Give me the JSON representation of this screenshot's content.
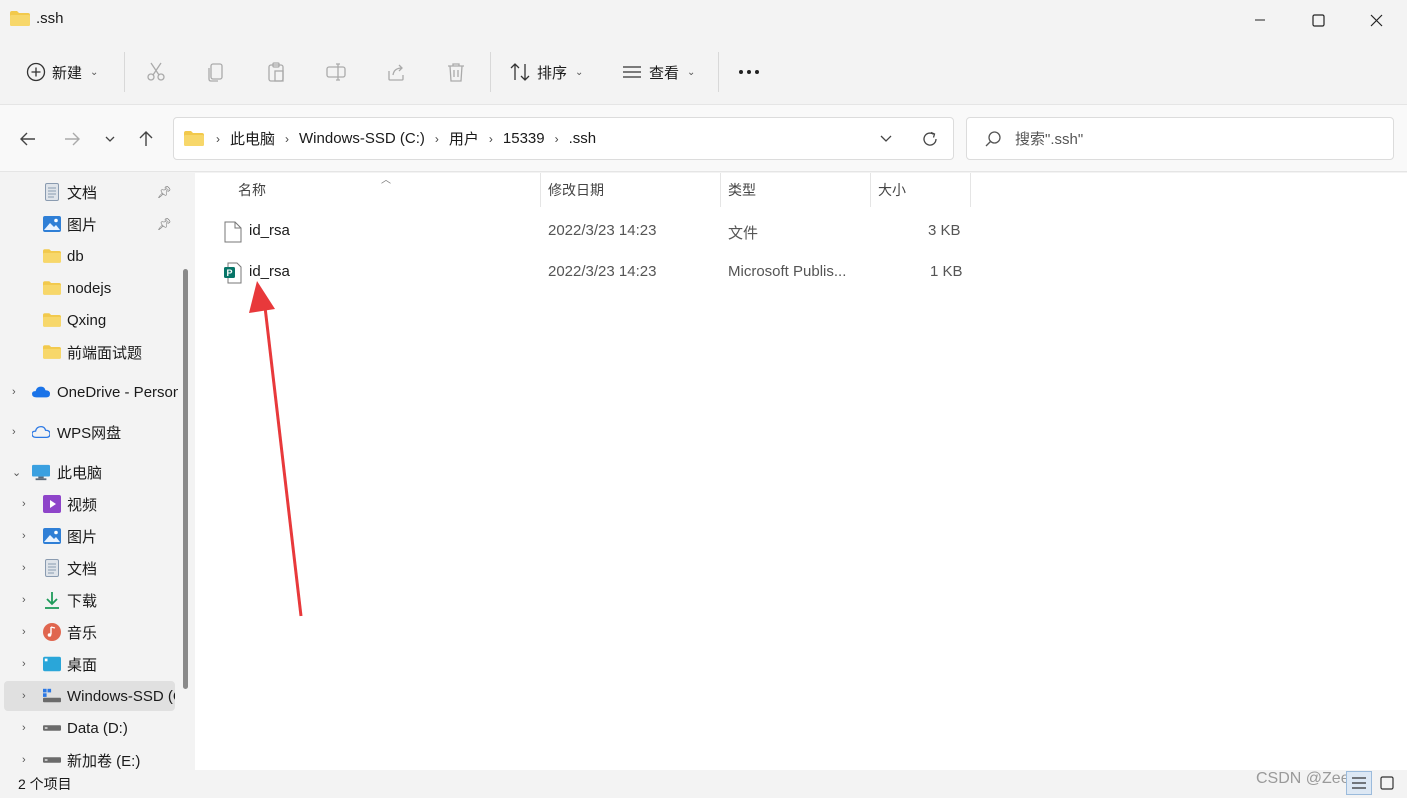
{
  "window": {
    "title": ".ssh"
  },
  "toolbar": {
    "new_label": "新建",
    "sort_label": "排序",
    "view_label": "查看"
  },
  "address": {
    "crumbs": [
      "此电脑",
      "Windows-SSD (C:)",
      "用户",
      "15339",
      ".ssh"
    ]
  },
  "search": {
    "placeholder": "搜索\".ssh\""
  },
  "sidebar": {
    "items": [
      {
        "label": "文档",
        "icon": "document-icon",
        "pinned": true
      },
      {
        "label": "图片",
        "icon": "pictures-icon",
        "pinned": true
      },
      {
        "label": "db",
        "icon": "folder-icon"
      },
      {
        "label": "nodejs",
        "icon": "folder-icon"
      },
      {
        "label": "Qxing",
        "icon": "folder-icon"
      },
      {
        "label": "前端面试题",
        "icon": "folder-icon"
      },
      {
        "label": "OneDrive - Personal",
        "icon": "onedrive-icon"
      },
      {
        "label": "WPS网盘",
        "icon": "wps-cloud-icon"
      },
      {
        "label": "此电脑",
        "icon": "computer-icon"
      },
      {
        "label": "视频",
        "icon": "videos-icon"
      },
      {
        "label": "图片",
        "icon": "pictures-icon"
      },
      {
        "label": "文档",
        "icon": "document-icon"
      },
      {
        "label": "下载",
        "icon": "downloads-icon"
      },
      {
        "label": "音乐",
        "icon": "music-icon"
      },
      {
        "label": "桌面",
        "icon": "desktop-icon"
      },
      {
        "label": "Windows-SSD (C:)",
        "icon": "drive-c-icon"
      },
      {
        "label": "Data (D:)",
        "icon": "drive-icon"
      },
      {
        "label": "新加卷 (E:)",
        "icon": "drive-icon"
      }
    ]
  },
  "columns": {
    "name": "名称",
    "modified": "修改日期",
    "type": "类型",
    "size": "大小"
  },
  "files": [
    {
      "name": "id_rsa",
      "modified": "2022/3/23 14:23",
      "type": "文件",
      "size": "3 KB",
      "icon": "generic-file-icon"
    },
    {
      "name": "id_rsa",
      "modified": "2022/3/23 14:23",
      "type": "Microsoft Publis...",
      "size": "1 KB",
      "icon": "publisher-file-icon"
    }
  ],
  "status": {
    "count": "2 个项目"
  },
  "watermark": "CSDN @Zeee.z",
  "colors": {
    "folder": "#f2c94c",
    "accent": "#0067c0",
    "annotation_arrow": "#e8393b"
  }
}
